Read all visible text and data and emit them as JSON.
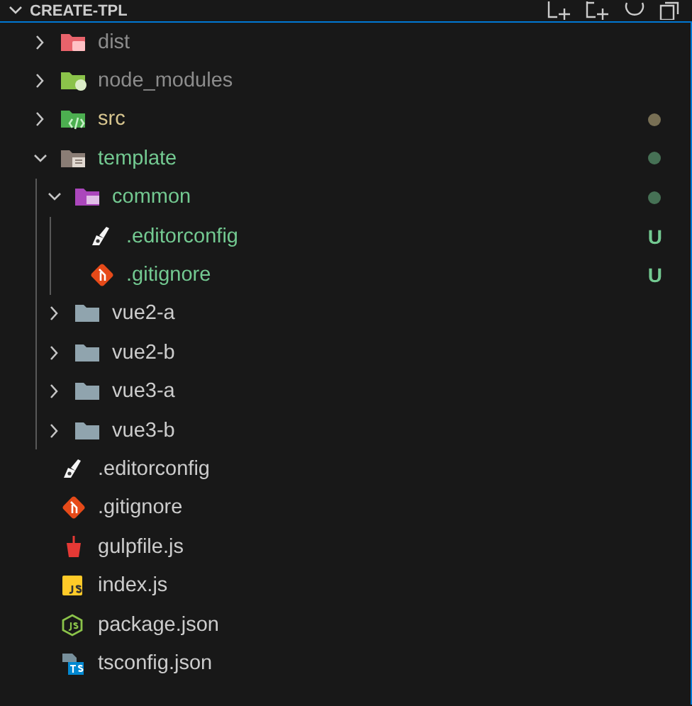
{
  "header": {
    "title": "CREATE-TPL",
    "expanded": true
  },
  "tree": [
    {
      "name": "dist",
      "kind": "dist",
      "expanded": false,
      "color": "#8c8c8c",
      "dot": false
    },
    {
      "name": "node_modules",
      "kind": "modules",
      "expanded": false,
      "color": "#8c8c8c",
      "dot": false
    },
    {
      "name": "src",
      "kind": "source",
      "expanded": false,
      "color": "#d7c58f",
      "dot": true
    },
    {
      "name": "template",
      "kind": "template",
      "expanded": true,
      "color": "#73c991",
      "dot": true,
      "children": [
        {
          "name": "common",
          "kind": "common",
          "expanded": true,
          "color": "#73c991",
          "dot": true,
          "children": [
            {
              "name": ".editorconfig",
              "kind": "editorconfig",
              "color": "#73c991",
              "badge": "U"
            },
            {
              "name": ".gitignore",
              "kind": "git",
              "color": "#73c991",
              "badge": "U"
            }
          ]
        },
        {
          "name": "vue2-a",
          "kind": "folder",
          "expanded": false,
          "color": "#cccccc",
          "dot": false
        },
        {
          "name": "vue2-b",
          "kind": "folder",
          "expanded": false,
          "color": "#cccccc",
          "dot": false
        },
        {
          "name": "vue3-a",
          "kind": "folder",
          "expanded": false,
          "color": "#cccccc",
          "dot": false
        },
        {
          "name": "vue3-b",
          "kind": "folder",
          "expanded": false,
          "color": "#cccccc",
          "dot": false
        }
      ]
    },
    {
      "name": ".editorconfig",
      "kind": "editorconfig",
      "color": "#cccccc"
    },
    {
      "name": ".gitignore",
      "kind": "git",
      "color": "#cccccc"
    },
    {
      "name": "gulpfile.js",
      "kind": "gulp",
      "color": "#cccccc"
    },
    {
      "name": "index.js",
      "kind": "script",
      "color": "#cccccc"
    },
    {
      "name": "package.json",
      "kind": "package",
      "color": "#cccccc"
    },
    {
      "name": "tsconfig.json",
      "kind": "tsconfig",
      "color": "#cccccc"
    }
  ]
}
